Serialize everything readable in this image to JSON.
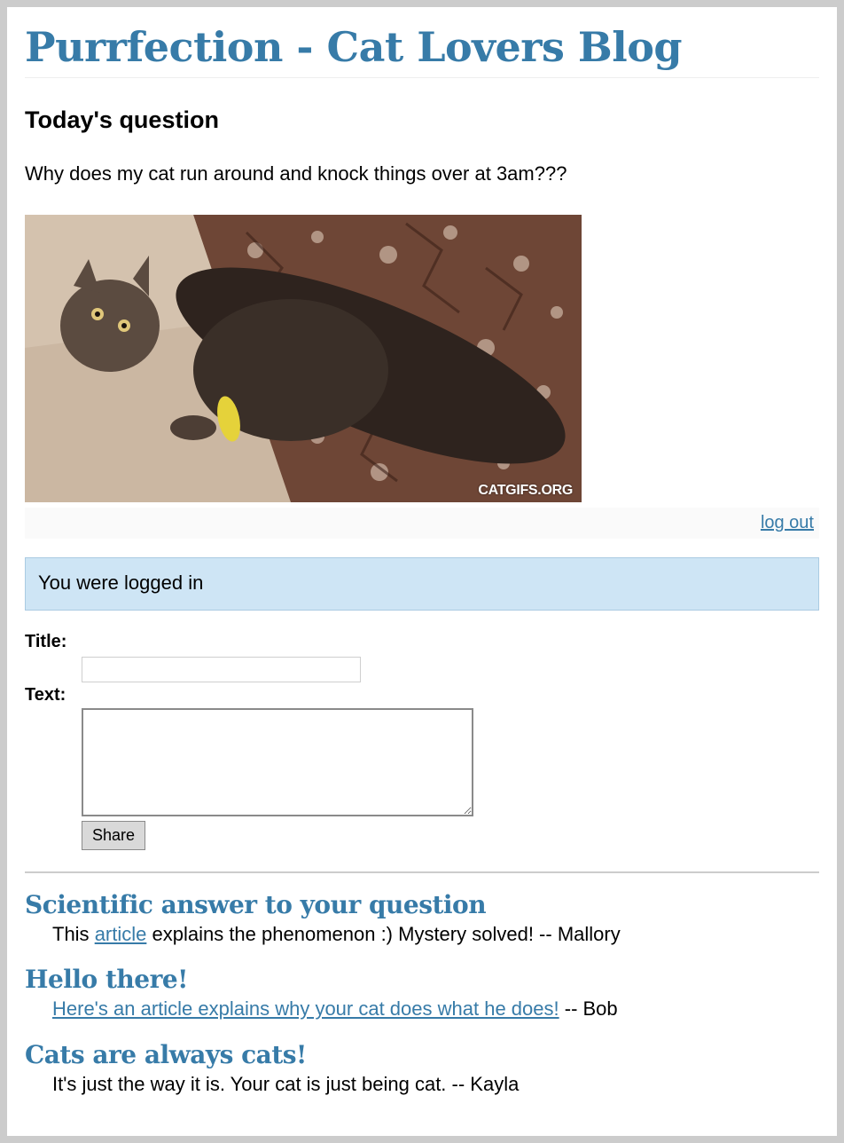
{
  "site": {
    "title": "Purrfection - Cat Lovers Blog"
  },
  "question": {
    "heading": "Today's question",
    "text": "Why does my cat run around and knock things over at 3am???",
    "image_watermark": "CATGIFS.ORG"
  },
  "metanav": {
    "logout_label": "log out"
  },
  "flash": {
    "message": "You were logged in"
  },
  "form": {
    "title_label": "Title:",
    "title_value": "",
    "text_label": "Text:",
    "text_value": "",
    "share_label": "Share"
  },
  "entries": [
    {
      "title": "Scientific answer to your question",
      "pre": "This ",
      "link": "article",
      "post": " explains the phenomenon :) Mystery solved! -- Mallory"
    },
    {
      "title": "Hello there!",
      "pre": "",
      "link": "Here's an article explains why your cat does what he does!",
      "post": " -- Bob"
    },
    {
      "title": "Cats are always cats!",
      "pre": "It's just the way it is. Your cat is just being cat. -- Kayla",
      "link": "",
      "post": ""
    }
  ],
  "colors": {
    "accent": "#377ba8",
    "flash_bg": "#cee5f5",
    "frame_bg": "#cccccc"
  }
}
